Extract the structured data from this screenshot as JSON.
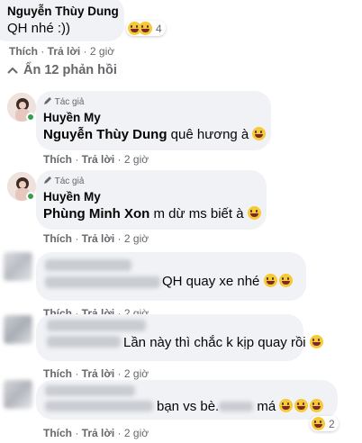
{
  "comment_top": {
    "name": "Nguyễn Thùy Dung",
    "text": "QH nhé :))",
    "reaction_count": "4",
    "like": "Thích",
    "reply": "Trả lời",
    "time": "2 giờ"
  },
  "hide_replies": "Ẩn 12 phản hồi",
  "replies": [
    {
      "author_badge": "Tác giả",
      "name": "Huyền My",
      "mention": "Nguyễn Thùy Dung",
      "text": " quê hương à ",
      "like": "Thích",
      "reply": "Trả lời",
      "time": "2 giờ"
    },
    {
      "author_badge": "Tác giả",
      "name": "Huyền My",
      "mention": "Phùng Minh Xon",
      "text": " m dừ ms biết à ",
      "like": "Thích",
      "reply": "Trả lời",
      "time": "2 giờ"
    },
    {
      "text": "QH quay xe nhé ",
      "like": "Thích",
      "reply": "Trả lời",
      "time": "2 giờ"
    },
    {
      "text": "Lần này thì chắc k kịp quay rồi ",
      "like": "Thích",
      "reply": "Trả lời",
      "time": "2 giờ"
    },
    {
      "text_a": " bạn vs bè.",
      "text_b": " má ",
      "reaction_count": "2",
      "like": "Thích",
      "reply": "Trả lời",
      "time": "2 giờ"
    }
  ],
  "colors": {
    "bubble": "#f0f2f5",
    "meta": "#65676b",
    "online": "#31a24c",
    "emoji": "#f7c935"
  }
}
